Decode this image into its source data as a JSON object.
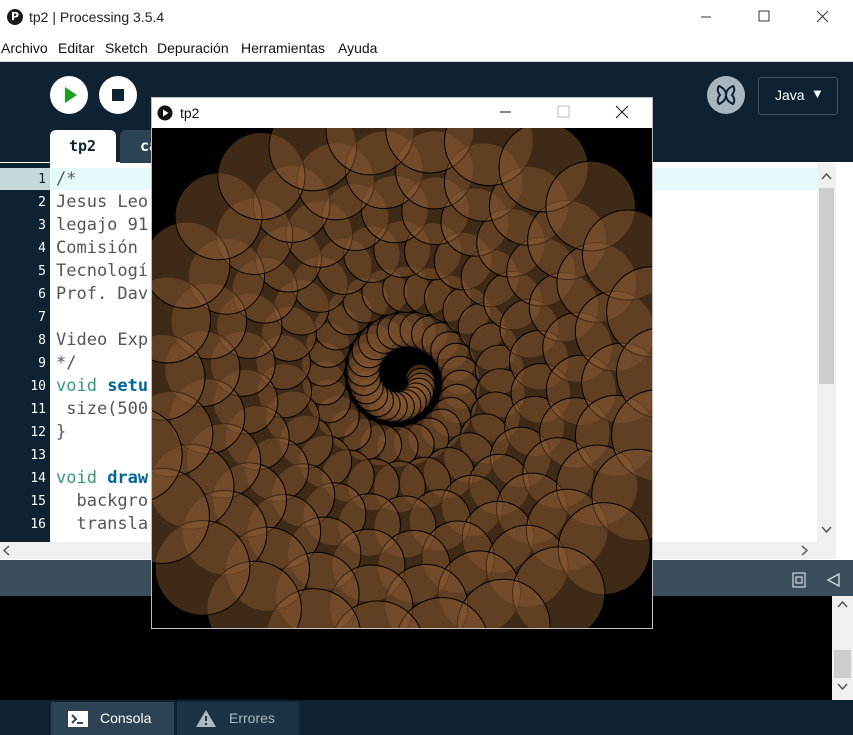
{
  "window": {
    "title": "tp2 | Processing 3.5.4",
    "icon": "processing-logo-icon"
  },
  "menu": [
    "Archivo",
    "Editar",
    "Sketch",
    "Depuración",
    "Herramientas",
    "Ayuda"
  ],
  "toolbar": {
    "mode_label": "Java",
    "mode_caret": "▼"
  },
  "tabs": {
    "active": "tp2",
    "second": "ca"
  },
  "editor": {
    "current_line": 1,
    "lines": [
      {
        "n": "1",
        "text": "/*"
      },
      {
        "n": "2",
        "text": "Jesus Leo"
      },
      {
        "n": "3",
        "text": "legajo 91"
      },
      {
        "n": "4",
        "text": "Comisión "
      },
      {
        "n": "5",
        "text": "Tecnologí"
      },
      {
        "n": "6",
        "text": "Prof. Dav"
      },
      {
        "n": "7",
        "text": ""
      },
      {
        "n": "8",
        "text": "Video Exp"
      },
      {
        "n": "9",
        "text": "*/"
      },
      {
        "n": "10",
        "kw": "void ",
        "fn": "setu"
      },
      {
        "n": "11",
        "text": " size(500"
      },
      {
        "n": "12",
        "text": "}"
      },
      {
        "n": "13",
        "text": ""
      },
      {
        "n": "14",
        "kw": "void ",
        "fn": "draw"
      },
      {
        "n": "15",
        "text": "  backgro"
      },
      {
        "n": "16",
        "text": "  transla"
      }
    ]
  },
  "footer": {
    "console_label": "Consola",
    "errors_label": "Errores"
  },
  "sketch_window": {
    "title": "tp2"
  },
  "colors": {
    "toolbar_bg": "#0e2232",
    "keyword": "#33997e",
    "function": "#006699",
    "circle_fill": "#8b5a34",
    "line_highlight": "#e5fbfb"
  }
}
